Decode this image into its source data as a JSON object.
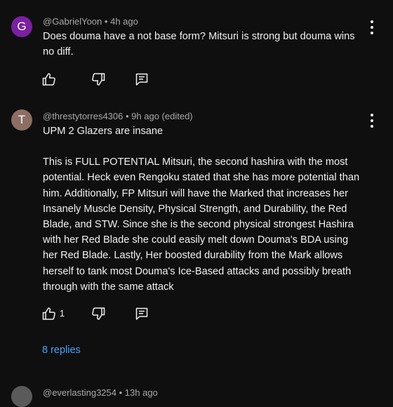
{
  "colors": {
    "background": "#0f0f0f",
    "text": "#f1f1f1",
    "meta": "#aaaaaa",
    "link": "#3ea6ff",
    "avatar_g": "#7b1fa2",
    "avatar_t": "#8d6e63"
  },
  "comments": [
    {
      "avatar_letter": "G",
      "author": "@GabrielYoon",
      "separator": "•",
      "time": "4h ago",
      "paragraphs": [
        "Does douma have a not base form? Mitsuri is strong but douma wins no diff."
      ],
      "like_count": "",
      "icons": [
        "thumb-up-icon",
        "thumb-down-icon",
        "reply-icon",
        "more-vert-icon"
      ]
    },
    {
      "avatar_letter": "T",
      "author": "@threstytorres4306",
      "separator": "•",
      "time": "9h ago (edited)",
      "paragraphs": [
        "UPM 2 Glazers are insane",
        "This is FULL POTENTIAL Mitsuri, the second hashira with the most potential. Heck even Rengoku stated that she has more potential than him. Additionally, FP Mitsuri will have the Marked that increases her Insanely Muscle Density, Physical Strength, and Durability, the Red Blade, and STW. Since she is the second physical strongest Hashira with her Red Blade she could easily melt down Douma's BDA using her Red Blade. Lastly, Her boosted durability from the Mark allows herself to tank most Douma's Ice-Based attacks and possibly breath through with the same attack"
      ],
      "like_count": "1",
      "replies_label": "8 replies",
      "icons": [
        "thumb-up-icon",
        "thumb-down-icon",
        "reply-icon",
        "more-vert-icon"
      ]
    },
    {
      "author": "@everlasting3254",
      "separator": "•",
      "time": "13h ago"
    }
  ]
}
